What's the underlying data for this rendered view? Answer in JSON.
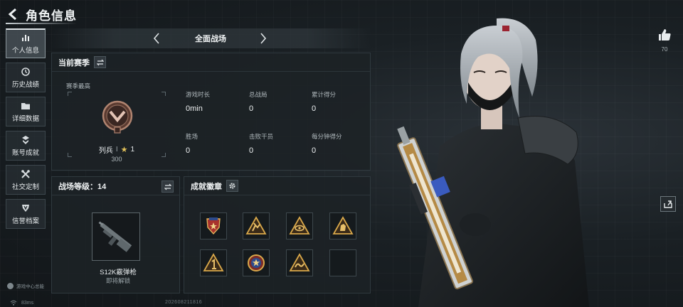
{
  "header": {
    "title": "角色信息"
  },
  "sidebar": {
    "items": [
      {
        "label": "个人信息",
        "icon": "bar-chart-icon",
        "active": true
      },
      {
        "label": "历史战绩",
        "icon": "history-icon",
        "active": false
      },
      {
        "label": "详细数据",
        "icon": "folder-icon",
        "active": false
      },
      {
        "label": "账号成就",
        "icon": "medal-icon",
        "active": false
      },
      {
        "label": "社交定制",
        "icon": "tools-icon",
        "active": false
      },
      {
        "label": "信誉档案",
        "icon": "shield-icon",
        "active": false
      }
    ],
    "footer": "游戏中心总能"
  },
  "mode": {
    "title": "全面战场"
  },
  "season": {
    "title": "当前赛季",
    "subtitle": "赛季最高",
    "rank_name": "列兵",
    "rank_sep": "I",
    "rank_stars": "1",
    "rank_score": "300"
  },
  "stats": [
    {
      "label": "游戏时长",
      "value": "0min"
    },
    {
      "label": "总战局",
      "value": "0"
    },
    {
      "label": "累计得分",
      "value": "0"
    },
    {
      "label": "胜场",
      "value": "0"
    },
    {
      "label": "击败干员",
      "value": "0"
    },
    {
      "label": "每分钟得分",
      "value": "0"
    }
  ],
  "battle_level": {
    "title": "战场等级：14",
    "weapon_name": "S12K霰弹枪",
    "weapon_status": "即将解锁"
  },
  "achievements": {
    "title": "成就徽章",
    "badges": [
      {
        "icon": "shield-star-badge-icon"
      },
      {
        "icon": "triangle-runner-badge-icon"
      },
      {
        "icon": "triangle-eye-badge-icon"
      },
      {
        "icon": "triangle-fist-badge-icon"
      },
      {
        "icon": "triangle-number-one-badge-icon"
      },
      {
        "icon": "round-star-badge-icon"
      },
      {
        "icon": "triangle-wave-badge-icon"
      },
      {
        "icon": "empty-slot"
      }
    ]
  },
  "social": {
    "likes": "70"
  },
  "status": {
    "ping": "83ms",
    "build": "202608211816"
  },
  "colors": {
    "accent": "#dfe5e8",
    "gold": "#d9a84a",
    "panel": "#1c2226"
  }
}
